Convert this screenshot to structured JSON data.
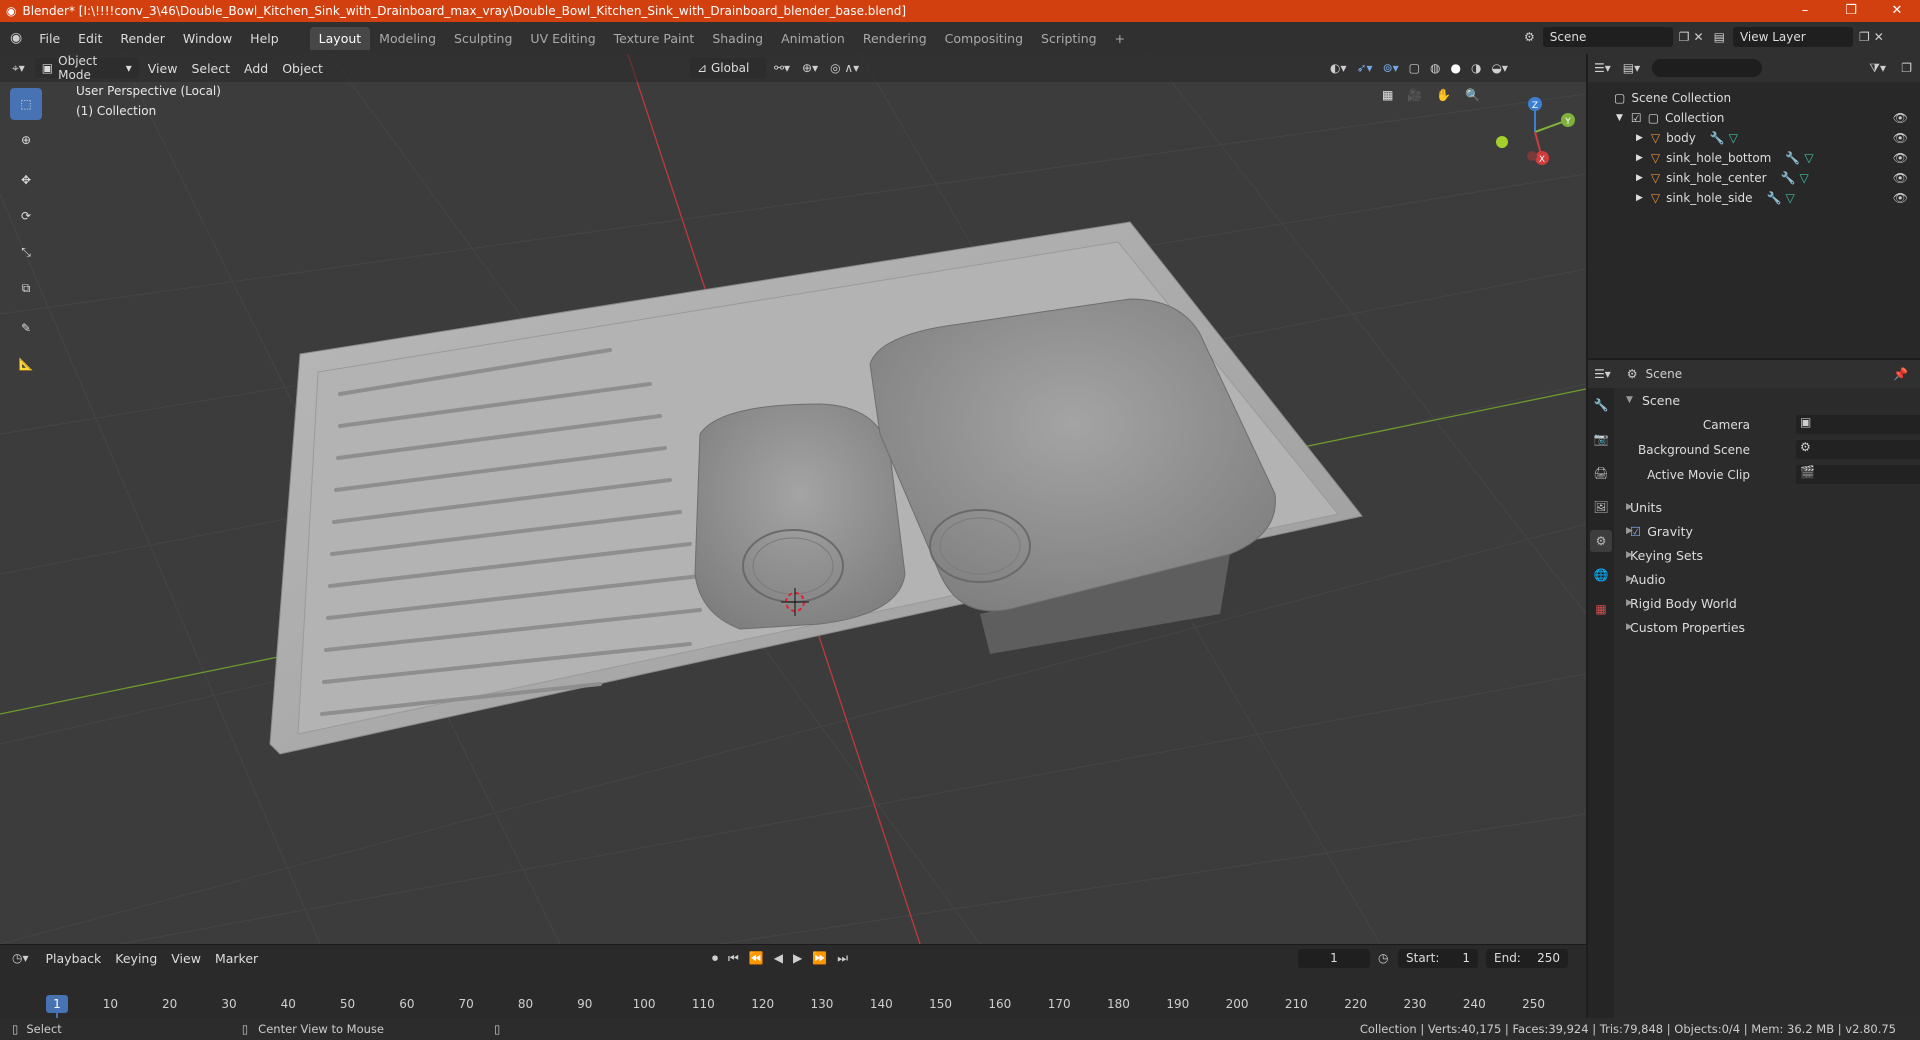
{
  "window": {
    "title": "Blender* [I:\\!!!!conv_3\\46\\Double_Bowl_Kitchen_Sink_with_Drainboard_max_vray\\Double_Bowl_Kitchen_Sink_with_Drainboard_blender_base.blend]"
  },
  "menu": [
    "File",
    "Edit",
    "Render",
    "Window",
    "Help"
  ],
  "workspaces": [
    "Layout",
    "Modeling",
    "Sculpting",
    "UV Editing",
    "Texture Paint",
    "Shading",
    "Animation",
    "Rendering",
    "Compositing",
    "Scripting"
  ],
  "active_workspace": "Layout",
  "scene_selector": "Scene",
  "view_layer": "View Layer",
  "viewport": {
    "mode": "Object Mode",
    "menus": [
      "View",
      "Select",
      "Add",
      "Object"
    ],
    "orientation": "Global",
    "perspective_label": "User Perspective (Local)",
    "collection_label": "(1) Collection",
    "gizmo_axes": {
      "x": "X",
      "y": "Y",
      "z": "Z"
    }
  },
  "outliner": {
    "search_placeholder": "",
    "root": "Scene Collection",
    "collection": "Collection",
    "objects": [
      "body",
      "sink_hole_bottom",
      "sink_hole_center",
      "sink_hole_side"
    ]
  },
  "properties": {
    "context": "Scene",
    "panel_title": "Scene",
    "fields": {
      "camera_label": "Camera",
      "background_scene_label": "Background Scene",
      "active_movie_clip_label": "Active Movie Clip"
    },
    "sections": [
      "Units",
      "Gravity",
      "Keying Sets",
      "Audio",
      "Rigid Body World",
      "Custom Properties"
    ],
    "gravity_checked": true
  },
  "timeline": {
    "menus": [
      "Playback",
      "Keying",
      "View",
      "Marker"
    ],
    "current_frame": "1",
    "start_label": "Start:",
    "start": "1",
    "end_label": "End:",
    "end": "250",
    "ticks": [
      "1",
      "10",
      "20",
      "30",
      "40",
      "50",
      "60",
      "70",
      "80",
      "90",
      "100",
      "110",
      "120",
      "130",
      "140",
      "150",
      "160",
      "170",
      "180",
      "190",
      "200",
      "210",
      "220",
      "230",
      "240",
      "250"
    ]
  },
  "statusbar": {
    "left_action": "Select",
    "middle_action": "Center View to Mouse",
    "stats": "Collection | Verts:40,175 | Faces:39,924 | Tris:79,848 | Objects:0/4 | Mem: 36.2 MB | v2.80.75"
  },
  "colors": {
    "title_bar": "#d2400f",
    "accent": "#4772b3",
    "axis_x": "#d03c3c",
    "axis_y": "#7fb13c",
    "axis_z": "#3c7fd0",
    "object_icon": "#e8913a"
  }
}
